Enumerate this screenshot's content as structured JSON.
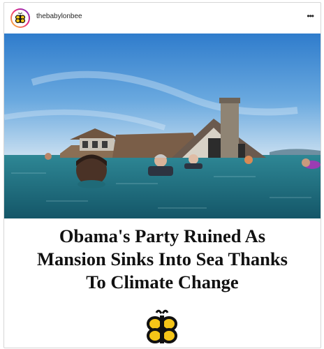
{
  "post": {
    "username": "thebabylonbee",
    "headline": {
      "line1": "Obama's Party Ruined As",
      "line2": "Mansion Sinks Into Sea Thanks",
      "line3": "To Climate Change"
    }
  },
  "icons": {
    "avatar": "babylon-bee-logo",
    "more": "more-options-icon",
    "brand": "bee-icon"
  },
  "colors": {
    "sky_top": "#2e7fcf",
    "sky_bottom": "#bcd9ef",
    "sea": "#1e6a7c",
    "logo_yellow": "#f5c518"
  }
}
